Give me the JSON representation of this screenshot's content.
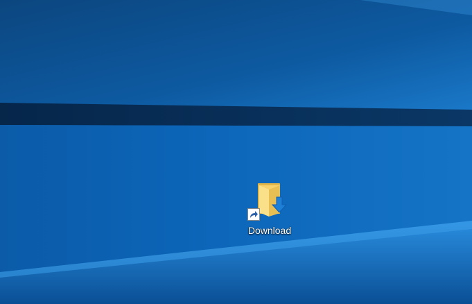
{
  "desktop": {
    "wallpaper": {
      "colors": {
        "base": "#0a5aa5",
        "dark_band": "#062a52",
        "light": "#3d9be6"
      }
    },
    "shortcuts": [
      {
        "label": "Download",
        "icon": "folder-download-icon",
        "overlay_icon": "shortcut-arrow-icon"
      }
    ]
  }
}
